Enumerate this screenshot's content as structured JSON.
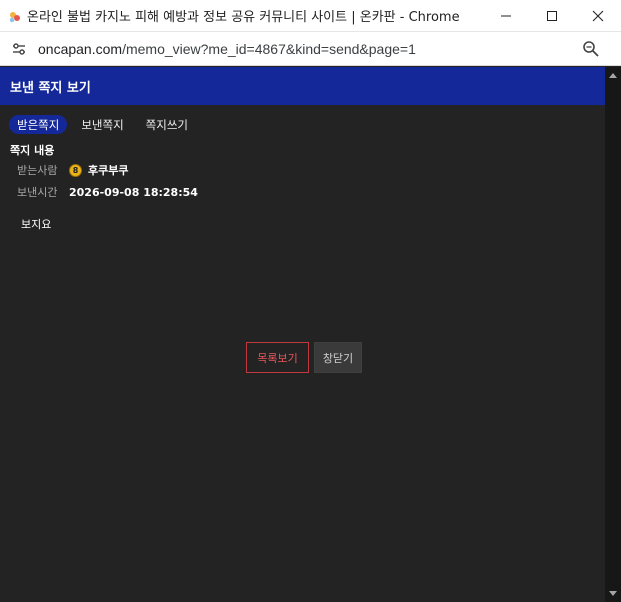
{
  "window": {
    "title": "온라인 불법 카지노 피해 예방과 정보 공유 커뮤니티 사이트 | 온카판 - Chrome",
    "url_host": "oncapan.com",
    "url_path": "/memo_view?me_id=4867&kind=send&page=1"
  },
  "header": {
    "title": "보낸 쪽지 보기"
  },
  "tabs": [
    {
      "label": "받은쪽지",
      "active": true
    },
    {
      "label": "보낸쪽지",
      "active": false
    },
    {
      "label": "쪽지쓰기",
      "active": false
    }
  ],
  "memo": {
    "section_title": "쪽지 내용",
    "recipient_label": "받는사람",
    "recipient_level": "8",
    "recipient_name": "후쿠부쿠",
    "sent_label": "보낸시간",
    "sent_time": "2026-09-08 18:28:54",
    "body": "보지요"
  },
  "actions": {
    "list_label": "목록보기",
    "close_label": "창닫기"
  },
  "colors": {
    "accent": "#14289a",
    "background": "#232323",
    "danger": "#c0393d"
  }
}
